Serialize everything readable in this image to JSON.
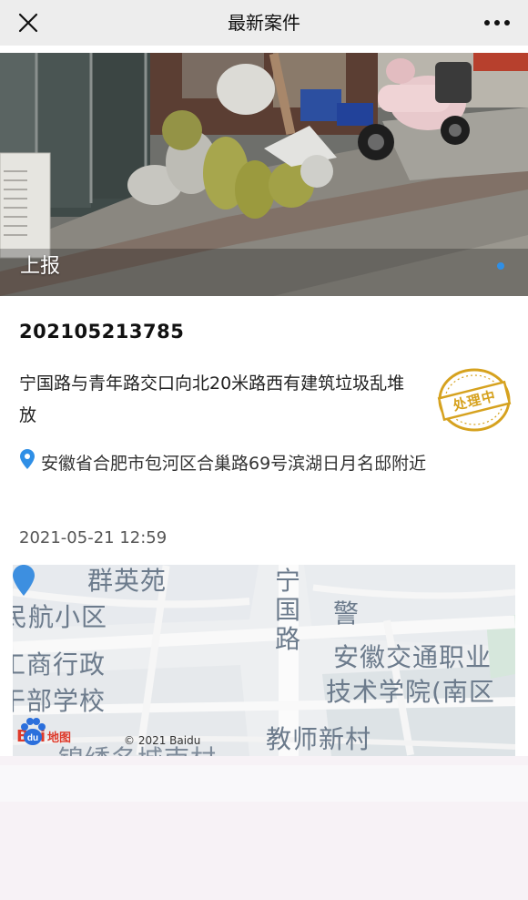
{
  "nav": {
    "title": "最新案件",
    "close_icon": "close-icon",
    "more_icon": "more-icon"
  },
  "photo": {
    "caption": "上报",
    "carousel_total": 1,
    "carousel_active": 1
  },
  "case": {
    "id": "202105213785",
    "description": "宁国路与青年路交口向北20米路西有建筑垃圾乱堆放",
    "status": "处理中",
    "address": "安徽省合肥市包河区合巢路69号滨湖日月名邸附近",
    "datetime": "2021-05-21 12:59"
  },
  "map": {
    "labels": {
      "top_partial": "群英苑",
      "residential": "民航小区",
      "bureau_1": "工商行政",
      "bureau_2": "干部学校",
      "police": "警",
      "school_1": "安徽交通职业",
      "school_2": "技术学院(南区",
      "village": "教师新村",
      "bottom_partial": "锦绣名城南村",
      "road": "宁国路"
    },
    "brand_left": "Bai",
    "brand_right": "du",
    "brand_product": "地图",
    "copyright": "© 2021 Baidu"
  },
  "colors": {
    "accent": "#2f8fe6",
    "stamp": "#d6a21f",
    "baidu_red": "#de3a2a",
    "pin_blue": "#3d8fe0"
  }
}
